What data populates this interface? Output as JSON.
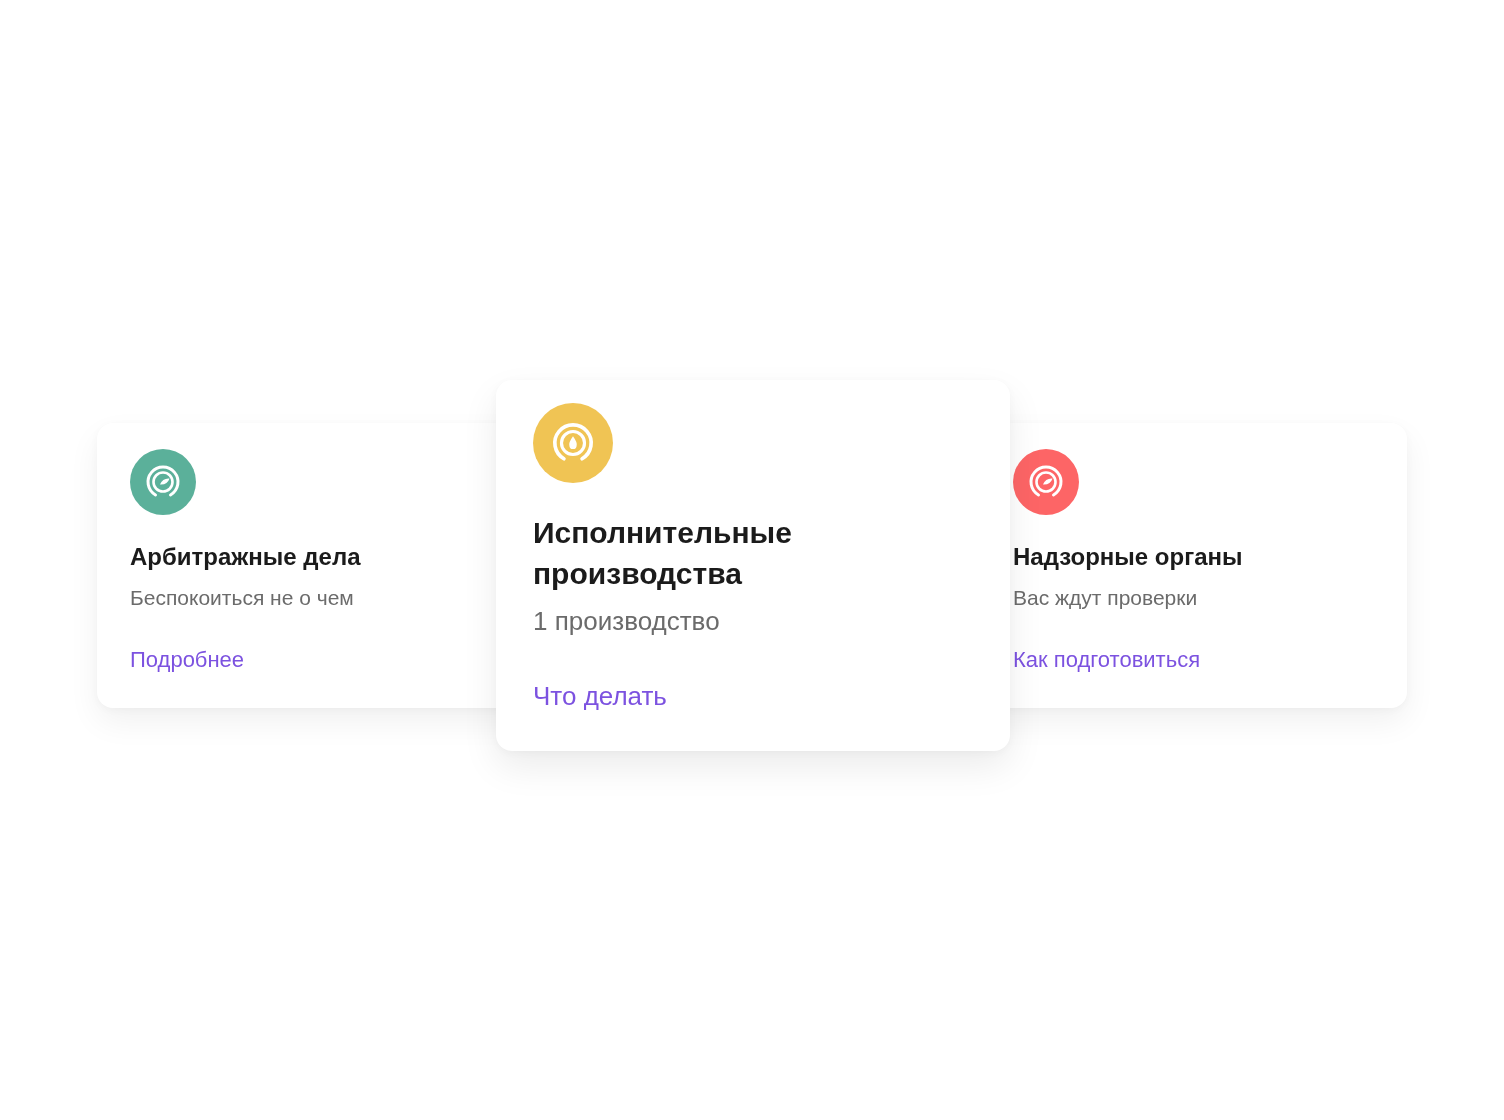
{
  "cards": [
    {
      "kind": "regular",
      "color": "#5bb09a",
      "title": "Арбитражные дела",
      "subtitle": "Беспокоиться не о чем",
      "link": "Подробнее"
    },
    {
      "kind": "featured",
      "color": "#f0c454",
      "title": "Исполнительные производства",
      "subtitle": "1 производство",
      "link": "Что делать"
    },
    {
      "kind": "regular",
      "color": "#fd6566",
      "title": "Надзорные органы",
      "subtitle": "Вас ждут проверки",
      "link": "Как подготовиться"
    }
  ]
}
